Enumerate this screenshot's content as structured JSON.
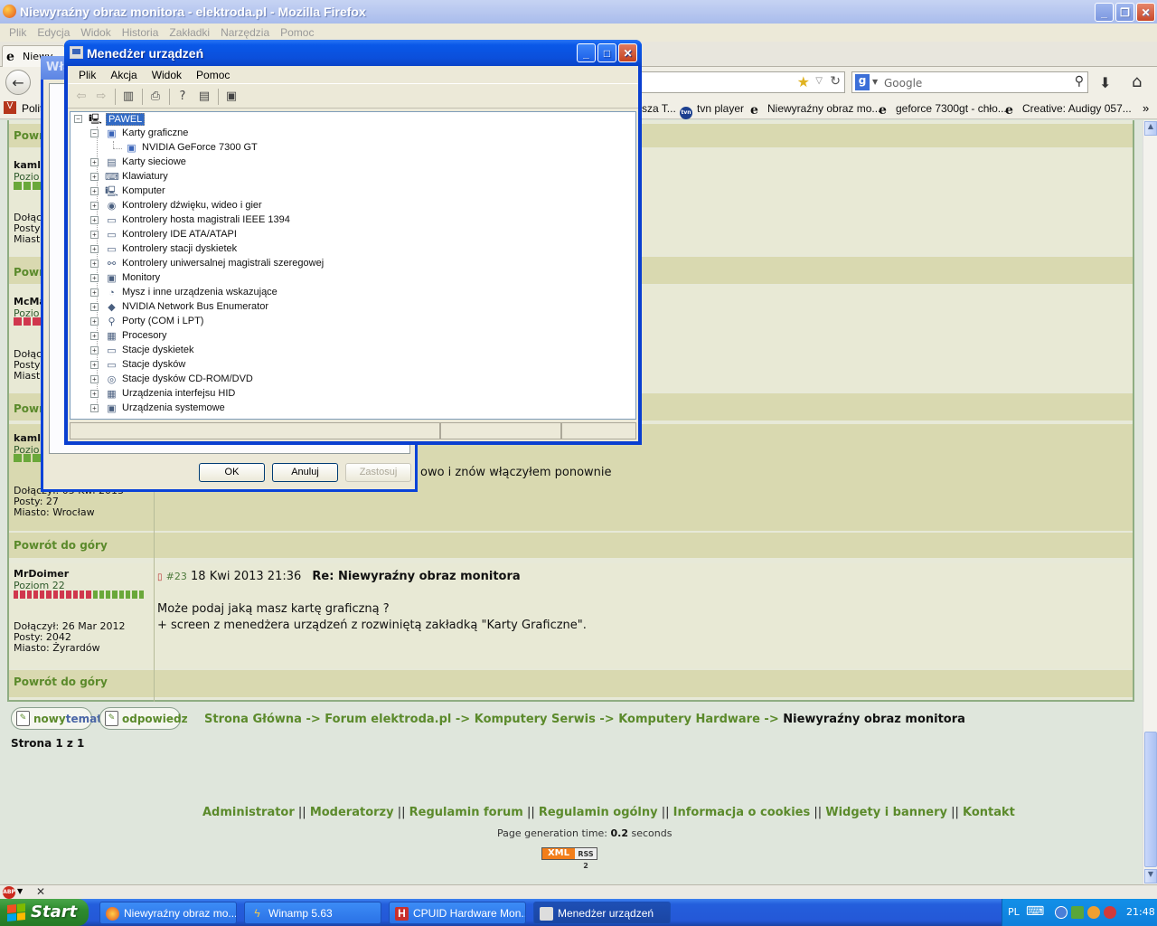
{
  "firefox": {
    "title": "Niewyraźny obraz monitora - elektroda.pl - Mozilla Firefox",
    "menu": [
      "Plik",
      "Edycja",
      "Widok",
      "Historia",
      "Zakładki",
      "Narzędzia",
      "Pomoc"
    ],
    "tab_label": "Niewy",
    "search_placeholder": "Google",
    "bookmarks": [
      {
        "label": "Polit",
        "icon": "polityka-icon"
      },
      {
        "label": "sza T...",
        "icon": "page-icon"
      },
      {
        "label": "tvn player",
        "icon": "tvn-icon"
      },
      {
        "label": "Niewyraźny obraz mo...",
        "icon": "elektroda-icon"
      },
      {
        "label": "geforce 7300gt - chło...",
        "icon": "elektroda-icon"
      },
      {
        "label": "Creative: Audigy 057...",
        "icon": "elektroda-icon"
      }
    ]
  },
  "forum": {
    "back_to_top": "Powrót do góry",
    "truncated": {
      "row1_user": "kaml",
      "row1_level": "Pozio",
      "row1_info": [
        "Dołąc",
        "Posty",
        "Miast"
      ],
      "powrot_short": "Powr",
      "row2_user": "McMa",
      "row2_level": "Pozio",
      "row2_info": [
        "Dołąc",
        "Posty",
        "Miast"
      ],
      "row3_user": "kaml",
      "row3_level": "Pozio",
      "row3_info_line1": "Dołączył: 05 Kwi 2013",
      "row3_posts": "Posty: 27",
      "row3_city": "Miasto: Wrocław",
      "row3_text": "owo i znów włączyłem ponownie"
    },
    "post": {
      "user": "MrDoimer",
      "level": "Poziom 22",
      "joined": "Dołączył: 26 Mar 2012",
      "posts": "Posty: 2042",
      "city": "Miasto: Żyrardów",
      "number": "#23",
      "date": "18 Kwi 2013 21:36",
      "subject": "Re: Niewyraźny obraz monitora",
      "line1": "Może podaj jaką masz kartę graficzną ?",
      "line2": "+ screen z menedżera urządzeń z rozwiniętą zakładką \"Karty Graficzne\"."
    },
    "btn_new_a": "nowy",
    "btn_new_b": "temat",
    "btn_reply": "odpowiedz",
    "breadcrumb": [
      "Strona Główna",
      "Forum elektroda.pl",
      "Komputery Serwis",
      "Komputery Hardware"
    ],
    "breadcrumb_sep": " -> ",
    "breadcrumb_current": "Niewyraźny obraz monitora",
    "pages": "Strona 1 z 1",
    "footer_links": [
      "Administrator",
      "Moderatorzy",
      "Regulamin forum",
      "Regulamin ogólny",
      "Informacja o cookies",
      "Widgety i bannery",
      "Kontakt"
    ],
    "footer_sep": " || ",
    "gen_label": "Page generation time: ",
    "gen_value": "0.2",
    "gen_unit": " seconds",
    "xml": "XML",
    "rss": "RSS 2"
  },
  "props_dialog": {
    "title": "Wła",
    "ok": "OK",
    "cancel": "Anuluj",
    "apply": "Zastosuj"
  },
  "device_manager": {
    "title": "Menedżer urządzeń",
    "menu": [
      "Plik",
      "Akcja",
      "Widok",
      "Pomoc"
    ],
    "root": "PAWEL",
    "expanded": "Karty graficzne",
    "child": "NVIDIA GeForce 7300 GT",
    "categories": [
      "Karty sieciowe",
      "Klawiatury",
      "Komputer",
      "Kontrolery dźwięku, wideo i gier",
      "Kontrolery hosta magistrali IEEE 1394",
      "Kontrolery IDE ATA/ATAPI",
      "Kontrolery stacji dyskietek",
      "Kontrolery uniwersalnej magistrali szeregowej",
      "Monitory",
      "Mysz i inne urządzenia wskazujące",
      "NVIDIA Network Bus Enumerator",
      "Porty (COM i LPT)",
      "Procesory",
      "Stacje dyskietek",
      "Stacje dysków",
      "Stacje dysków CD-ROM/DVD",
      "Urządzenia interfejsu HID",
      "Urządzenia systemowe"
    ]
  },
  "taskbar": {
    "start": "Start",
    "tasks": [
      {
        "label": "Niewyraźny obraz mo...",
        "icon": "firefox-icon"
      },
      {
        "label": "Winamp 5.63",
        "icon": "winamp-icon"
      },
      {
        "label": "CPUID Hardware Mon...",
        "icon": "cpuid-icon"
      },
      {
        "label": "Menedżer urządzeń",
        "icon": "device-manager-icon"
      }
    ],
    "lang": "PL",
    "clock": "21:48"
  },
  "colors": {
    "forum_green": "#5b8a2b",
    "xp_blue": "#0a58e8",
    "rank_red": "#d0374d",
    "rank_green": "#6aa83a"
  }
}
